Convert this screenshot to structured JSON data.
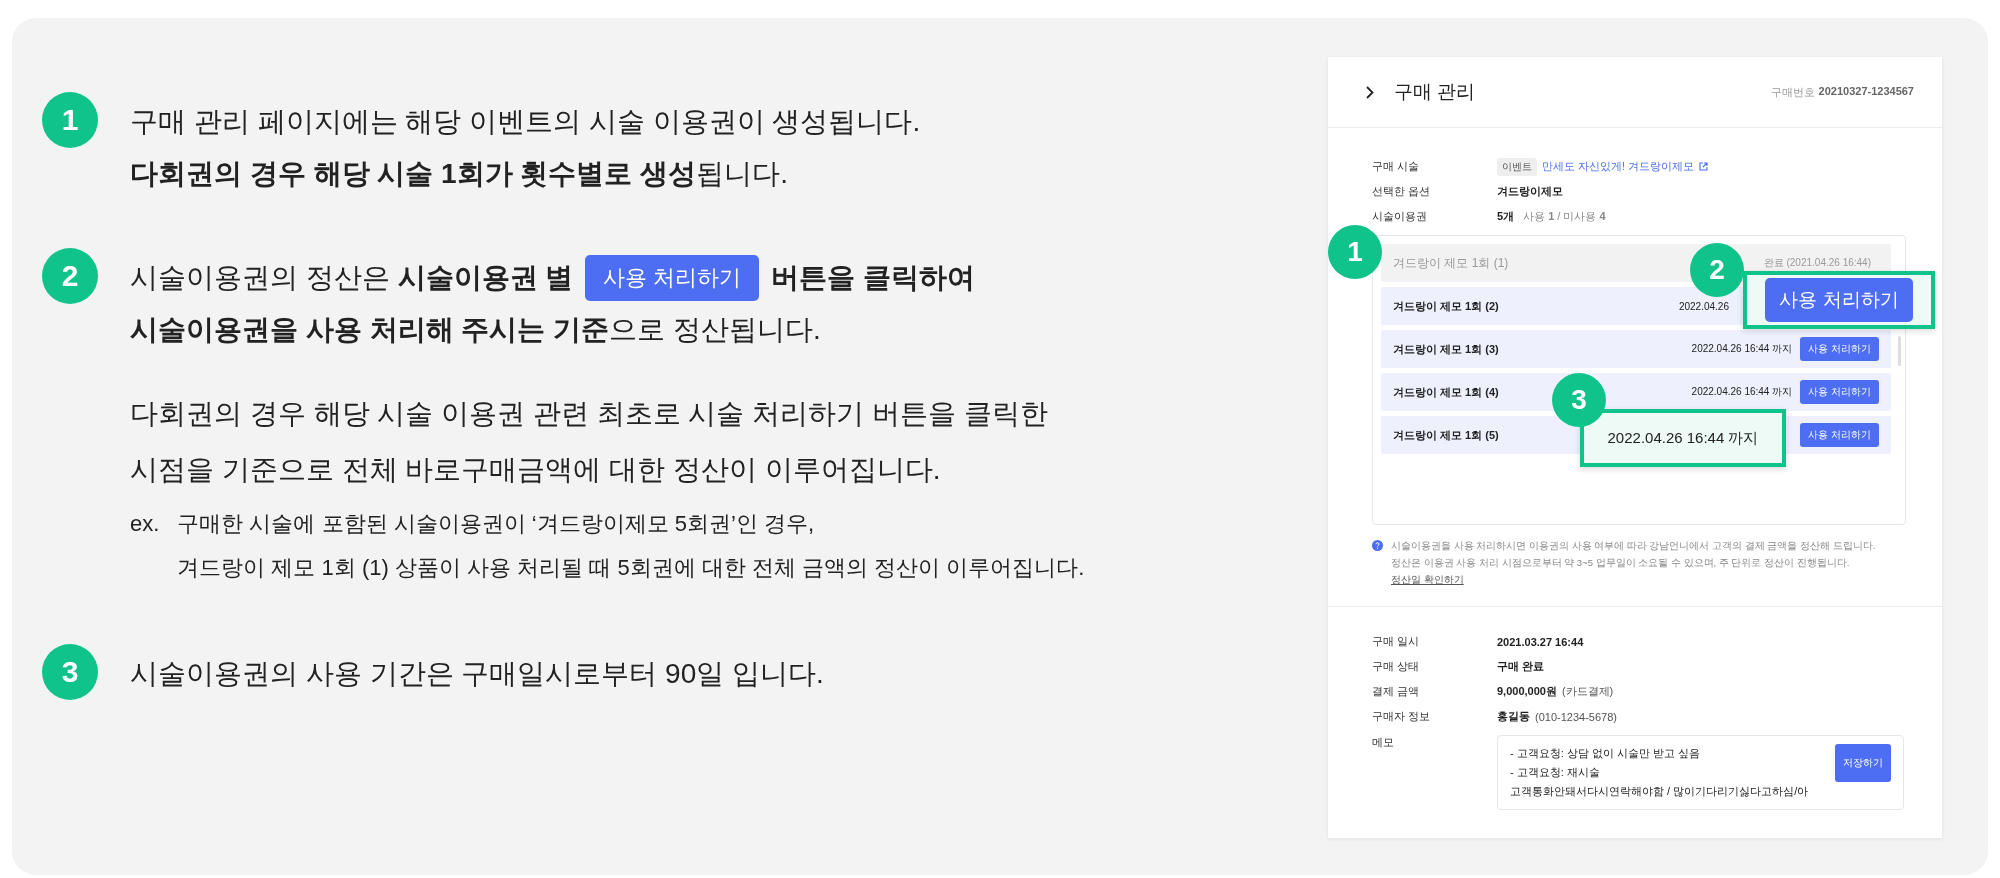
{
  "steps": [
    {
      "number": "1",
      "lines": [
        {
          "text": "구매 관리 페이지에는 해당 이벤트의 시술 이용권이 생성됩니다."
        },
        {
          "text": "**다회권의 경우 해당 시술 1회가 횟수별로 생성**됩니다."
        }
      ]
    },
    {
      "number": "2",
      "lines": [
        {
          "text": "시술이용권의 정산은 **시술이용권 별**",
          "button": "사용 처리하기",
          "after": "**버튼을 클릭하여**"
        },
        {
          "text": "**시술이용권을 사용 처리해 주시는 기준**으로 정산됩니다."
        }
      ],
      "note": [
        "다회권의 경우 해당 시술 이용권 관련 최초로 시술 처리하기 버튼을 클릭한",
        "시점을 기준으로 전체 바로구매금액에 대한 정산이 이루어집니다."
      ],
      "example": {
        "prefix": "ex.",
        "lines": [
          "구매한 시술에 포함된 시술이용권이 ‘겨드랑이제모 5회권’인 경우,",
          "겨드랑이 제모 1회 (1) 상품이 사용 처리될 때 5회권에 대한 전체 금액의 정산이 이루어집니다."
        ]
      }
    },
    {
      "number": "3",
      "lines": [
        {
          "text": "시술이용권의 사용 기간은 구매일시로부터 90일 입니다."
        }
      ]
    }
  ],
  "panel": {
    "title": "구매 관리",
    "order_label": "구매번호",
    "order_number": "20210327-1234567",
    "info": [
      {
        "label": "구매 시술",
        "tag": "이벤트",
        "link": "만세도 자신있게! 겨드랑이제모"
      },
      {
        "label": "선택한 옵션",
        "value": "겨드랑이제모"
      },
      {
        "label": "시술이용권",
        "value": "5개",
        "detail": "사용 **1** / 미사용 **4**"
      }
    ],
    "tickets": [
      {
        "name": "겨드랑이 제모 1회 (1)",
        "used": true,
        "status": "완료 (2021.04.26 16:44)"
      },
      {
        "name": "겨드랑이 제모 1회 (2)",
        "used": false,
        "status": "2022.04.26"
      },
      {
        "name": "겨드랑이 제모 1회 (3)",
        "used": false,
        "status": "2022.04.26 16:44 까지",
        "button": "사용 처리하기"
      },
      {
        "name": "겨드랑이 제모 1회 (4)",
        "used": false,
        "status": "2022.04.26 16:44 까지",
        "button": "사용 처리하기"
      },
      {
        "name": "겨드랑이 제모 1회 (5)",
        "used": false,
        "button": "사용 처리하기"
      }
    ],
    "notice": {
      "lines": [
        "시술이용권을 사용 처리하시면 이용권의 사용 여부에 따라 강남언니에서 고객의 결제 금액을 정산해 드립니다.",
        "정산은 이용권 사용 처리 시점으로부터 약 3~5 업무일이 소요될 수 있으며, 주 단위로 정산이 진행됩니다."
      ],
      "link": "정산일 확인하기"
    },
    "details": [
      {
        "label": "구매 일시",
        "value": "2021.03.27 16:44"
      },
      {
        "label": "구매 상태",
        "value": "구매 완료"
      },
      {
        "label": "결제 금액",
        "value": "9,000,000원",
        "extra": "(카드결제)"
      },
      {
        "label": "구매자 정보",
        "value": "홍길동",
        "extra": "(010-1234-5678)"
      }
    ],
    "memo": {
      "label": "메모",
      "lines": [
        "- 고객요청: 상담 없이 시술만 받고 싶음",
        "- 고객요청: 재시술",
        "고객통화안돼서다시연락해야함 / 많이기다리기싫다고하심/아"
      ],
      "button": "저장하기"
    },
    "callouts": [
      {
        "kind": "badge",
        "number": "1"
      },
      {
        "kind": "button",
        "number": "2",
        "button": "사용 처리하기"
      },
      {
        "kind": "date",
        "number": "3",
        "text": "2022.04.26 16:44 까지"
      }
    ]
  }
}
